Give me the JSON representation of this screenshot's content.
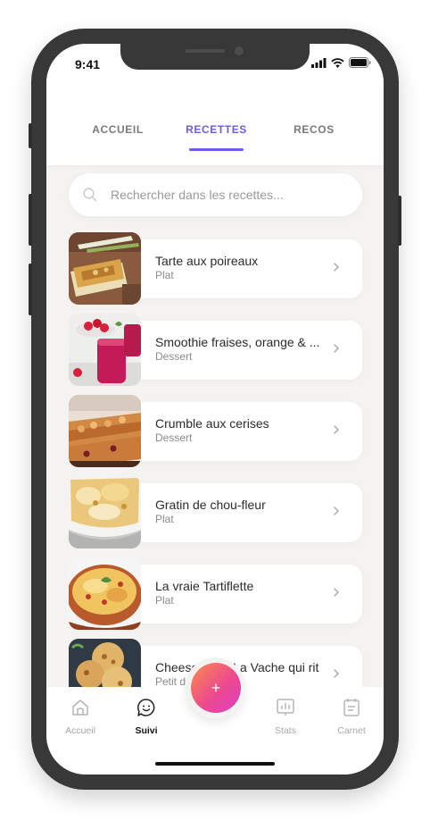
{
  "status_bar": {
    "time": "9:41"
  },
  "tabs": [
    {
      "label": "ACCUEIL",
      "active": false
    },
    {
      "label": "RECETTES",
      "active": true
    },
    {
      "label": "RECOS",
      "active": false
    }
  ],
  "search": {
    "placeholder": "Rechercher dans les recettes...",
    "value": "",
    "icon": "search-icon"
  },
  "recipes": [
    {
      "title": "Tarte aux poireaux",
      "category": "Plat",
      "image": "leek-tart-photo"
    },
    {
      "title": "Smoothie fraises, orange & ...",
      "category": "Dessert",
      "image": "strawberry-smoothie-photo"
    },
    {
      "title": "Crumble aux cerises",
      "category": "Dessert",
      "image": "cherry-crumble-photo"
    },
    {
      "title": "Gratin de chou-fleur",
      "category": "Plat",
      "image": "cauliflower-gratin-photo"
    },
    {
      "title": "La vraie Tartiflette",
      "category": "Plat",
      "image": "tartiflette-photo"
    },
    {
      "title": "Cheese naan La Vache qui rit",
      "category": "Petit déj ou entrée",
      "image": "cheese-naan-photo"
    }
  ],
  "bottom_nav": [
    {
      "label": "Accueil",
      "icon": "home-icon",
      "active": false
    },
    {
      "label": "Suivi",
      "icon": "chat-icon",
      "active": true
    },
    {
      "label": "Stats",
      "icon": "stats-icon",
      "active": false
    },
    {
      "label": "Carnet",
      "icon": "notebook-icon",
      "active": false
    }
  ],
  "fab": {
    "label": "+",
    "icon": "plus-icon"
  },
  "colors": {
    "accent": "#6c5ce7",
    "fab_gradient_start": "#f98d4a",
    "fab_gradient_end": "#d93ec5",
    "background": "#f4f3f1"
  }
}
